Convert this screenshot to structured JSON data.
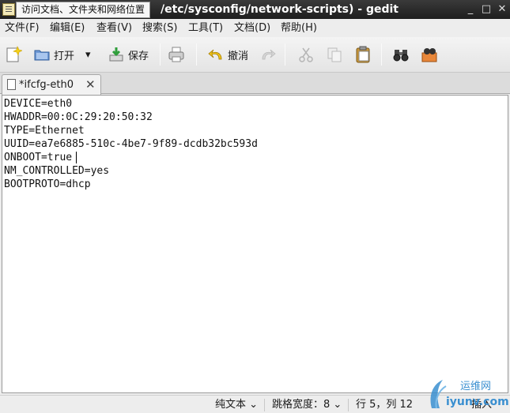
{
  "window": {
    "tooltip": "访问文档、文件夹和网络位置",
    "title": "/etc/sysconfig/network-scripts) - gedit",
    "minimize": "_",
    "maximize": "□",
    "close": "✕"
  },
  "menu": [
    "文件(F)",
    "编辑(E)",
    "查看(V)",
    "搜索(S)",
    "工具(T)",
    "文档(D)",
    "帮助(H)"
  ],
  "toolbar": {
    "open_label": "打开",
    "open_arrow": "▾",
    "save_label": "保存",
    "undo_label": "撤消"
  },
  "tab": {
    "label": "*ifcfg-eth0",
    "close": "✕"
  },
  "editor": {
    "lines": [
      "DEVICE=eth0",
      "HWADDR=00:0C:29:20:50:32",
      "TYPE=Ethernet",
      "UUID=ea7e6885-510c-4be7-9f89-dcdb32bc593d",
      "ONBOOT=true",
      "NM_CONTROLLED=yes",
      "BOOTPROTO=dhcp"
    ]
  },
  "status": {
    "mode": "纯文本 ⌄",
    "tab_width": "跳格宽度：8 ⌄",
    "position": "行 5，列 12",
    "insert": "插入"
  },
  "watermark": {
    "text_cn": "运维网",
    "text_en": "iyunv.com"
  },
  "colors": {
    "titlebar": "#2a2a2a",
    "background": "#ededed",
    "editor_bg": "#ffffff",
    "watermark": "#3a8fd0"
  }
}
